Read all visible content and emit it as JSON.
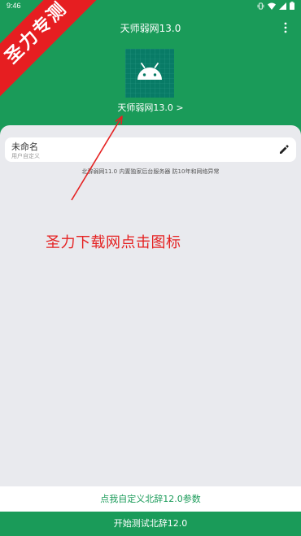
{
  "status_bar": {
    "time": "9:46",
    "icons": [
      "vibrate-icon",
      "wifi-icon",
      "signal-icon",
      "battery-icon"
    ]
  },
  "ribbon": {
    "text": "圣力专测"
  },
  "appbar": {
    "title": "天师弱网13.0",
    "menu_icon": "more-vertical-icon"
  },
  "app": {
    "logo_icon": "android-icon",
    "name_link": "天师弱网13.0 >"
  },
  "name_card": {
    "title": "未命名",
    "subtitle": "用户自定义",
    "edit_icon": "pencil-icon"
  },
  "info": {
    "text": "北辞弱网11.0 内置独家后台服务器 防10年和网络异常"
  },
  "annotation": {
    "text": "圣力下载网点击图标"
  },
  "buttons": {
    "custom_params": "点我自定义北辞12.0参数",
    "start_test": "开始测试北辞12.0"
  },
  "colors": {
    "primary_green": "#1a9b59",
    "logo_teal": "#087b66",
    "ribbon_red": "#e61e21",
    "annotation_red": "#e52222",
    "background": "#e9eaee"
  }
}
